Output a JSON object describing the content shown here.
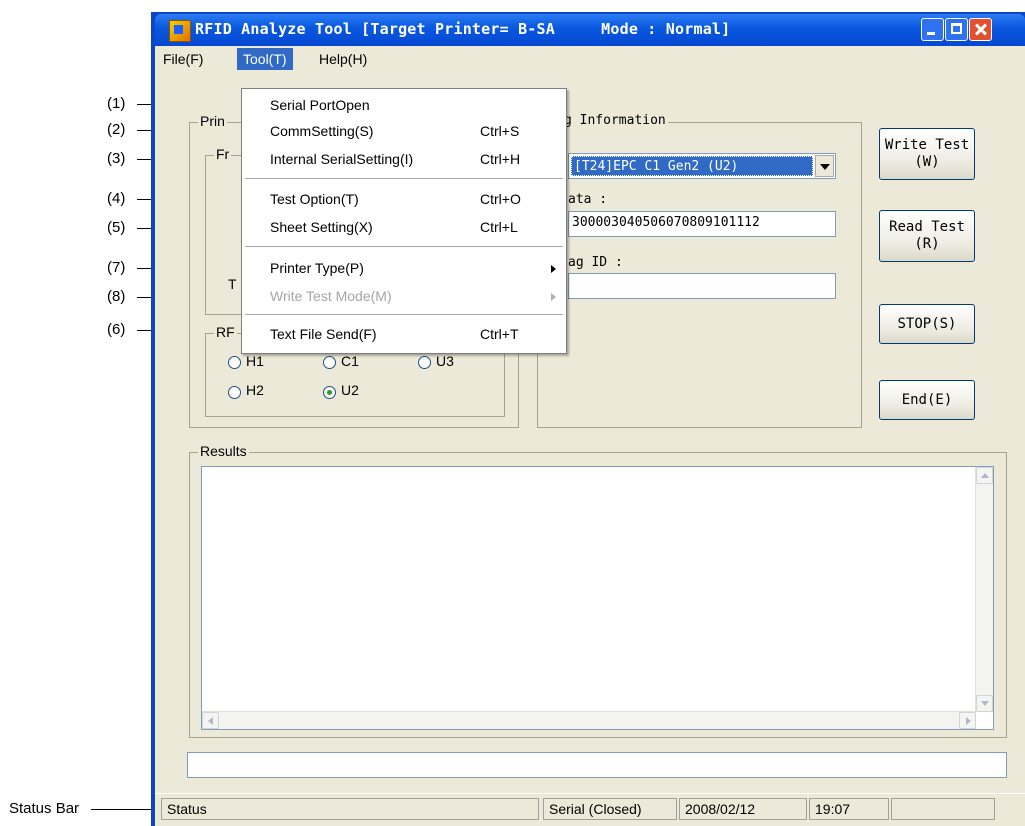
{
  "window": {
    "title": "RFID Analyze Tool [Target Printer= B-SA     Mode : Normal]"
  },
  "menubar": {
    "file": "File(F)",
    "tool": "Tool(T)",
    "help": "Help(H)"
  },
  "tool_menu": {
    "items": [
      {
        "label": "Serial PortOpen",
        "shortcut": ""
      },
      {
        "label": "CommSetting(S)",
        "shortcut": "Ctrl+S"
      },
      {
        "label": "Internal SerialSetting(I)",
        "shortcut": "Ctrl+H"
      },
      {
        "label": "Test Option(T)",
        "shortcut": "Ctrl+O"
      },
      {
        "label": "Sheet Setting(X)",
        "shortcut": "Ctrl+L"
      },
      {
        "label": "Printer Type(P)",
        "shortcut": ""
      },
      {
        "label": "Write Test Mode(M)",
        "shortcut": ""
      },
      {
        "label": "Text File Send(F)",
        "shortcut": "Ctrl+T"
      }
    ]
  },
  "annotations": [
    "(1)",
    "(2)",
    "(3)",
    "(4)",
    "(5)",
    "(7)",
    "(8)",
    "(6)",
    "Status Bar"
  ],
  "left_panel": {
    "group_label": "Prin",
    "sub_group_label": "Fr",
    "partial_label": "T",
    "rf_group_label": "RF",
    "radio_h1": "H1",
    "radio_c1": "C1",
    "radio_u3": "U3",
    "radio_h2": "H2",
    "radio_u2": "U2"
  },
  "tag_info": {
    "group_label": "g Information",
    "tag_type": "[T24]EPC C1 Gen2 (U2)",
    "data_label": "ata :",
    "data_value": "30000304050607080910111​2",
    "tag_id_label": "ag ID :",
    "tag_id_value": ""
  },
  "buttons": {
    "write_test": "Write Test",
    "write_test_key": "(W)",
    "read_test": "Read Test",
    "read_test_key": "(R)",
    "stop": "STOP(S)",
    "end": "End(E)"
  },
  "results": {
    "label": "Results",
    "text": ""
  },
  "statusbar": {
    "status": "Status",
    "port": "Serial (Closed)",
    "date": "2008/02/12",
    "time": "19:07"
  },
  "colors": {
    "title_bar": "#0a59e0",
    "menu_highlight": "#316ac5",
    "face": "#ece9d8"
  }
}
